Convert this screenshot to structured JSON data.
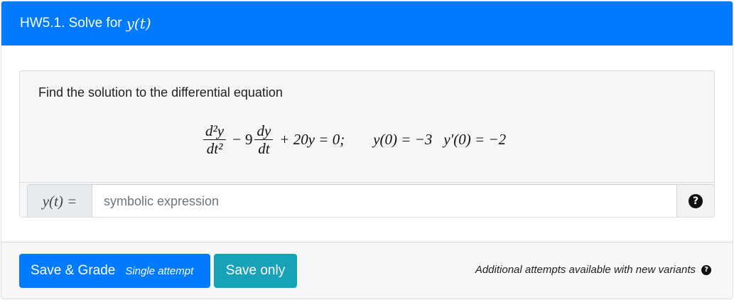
{
  "header": {
    "title_prefix": "HW5.1. Solve for",
    "title_math": "y(t)"
  },
  "question": {
    "prompt": "Find the solution to the differential equation",
    "equation": {
      "frac1_num": "d²y",
      "frac1_den": "dt²",
      "minus": "−",
      "coef": "9",
      "frac2_num": "dy",
      "frac2_den": "dt",
      "rest": "+ 20y = 0;",
      "ic1": "y(0) = −3",
      "ic2": "y′(0) = −2"
    }
  },
  "answer": {
    "label": "y(t) =",
    "placeholder": "symbolic expression",
    "value": "",
    "help_icon": "question-circle-icon"
  },
  "footer": {
    "save_grade_label": "Save & Grade",
    "save_grade_sub": "Single attempt",
    "save_only_label": "Save only",
    "attempts_note": "Additional attempts available with new variants"
  },
  "colors": {
    "primary": "#007bff",
    "info": "#17a2b8"
  }
}
